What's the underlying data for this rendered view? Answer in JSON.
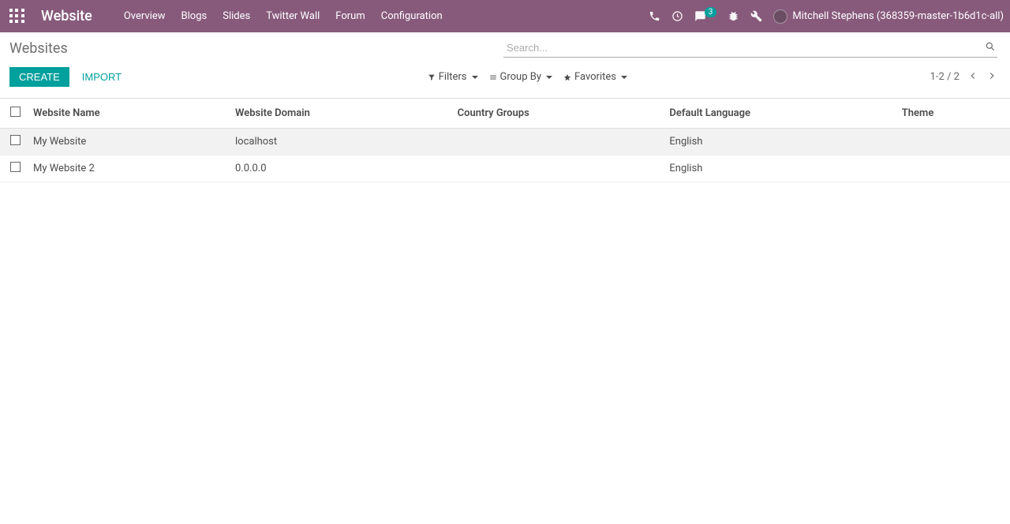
{
  "navbar": {
    "brand": "Website",
    "menu": [
      "Overview",
      "Blogs",
      "Slides",
      "Twitter Wall",
      "Forum",
      "Configuration"
    ],
    "badge_count": "3",
    "username": "Mitchell Stephens (368359-master-1b6d1c-all)"
  },
  "breadcrumb": "Websites",
  "search": {
    "placeholder": "Search..."
  },
  "buttons": {
    "create": "CREATE",
    "import": "IMPORT"
  },
  "filters": {
    "filters": "Filters",
    "groupby": "Group By",
    "favorites": "Favorites"
  },
  "pager": {
    "range": "1-2",
    "sep": "/",
    "total": "2"
  },
  "table": {
    "headers": {
      "name": "Website Name",
      "domain": "Website Domain",
      "country": "Country Groups",
      "lang": "Default Language",
      "theme": "Theme"
    },
    "rows": [
      {
        "name": "My Website",
        "domain": "localhost",
        "country": "",
        "lang": "English",
        "theme": ""
      },
      {
        "name": "My Website 2",
        "domain": "0.0.0.0",
        "country": "",
        "lang": "English",
        "theme": ""
      }
    ]
  }
}
